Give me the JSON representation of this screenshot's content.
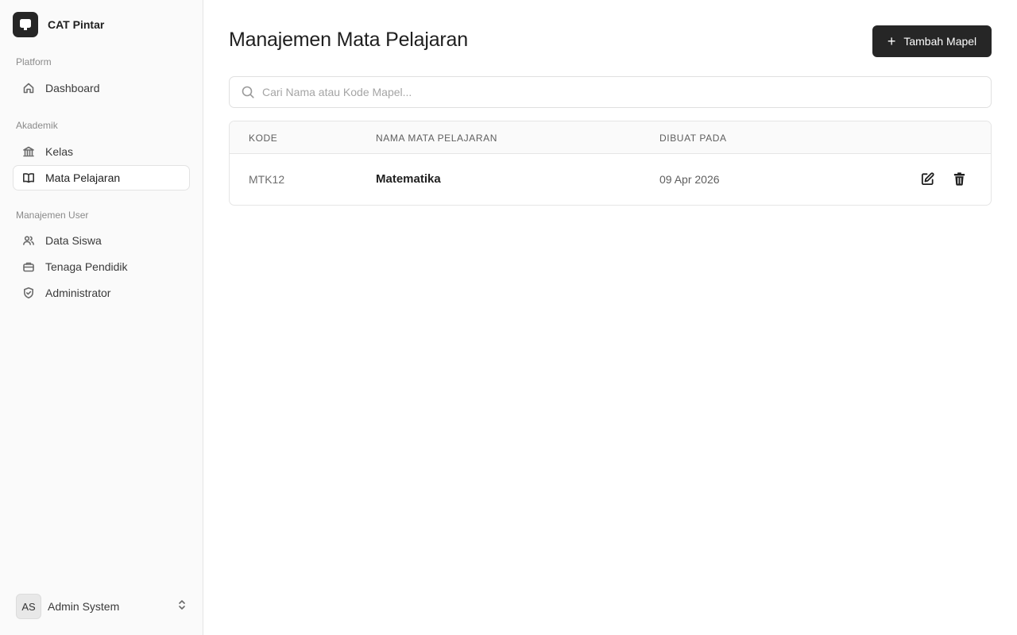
{
  "app": {
    "name": "CAT Pintar"
  },
  "sidebar": {
    "groups": [
      {
        "label": "Platform",
        "items": [
          {
            "label": "Dashboard",
            "icon": "home-icon"
          }
        ]
      },
      {
        "label": "Akademik",
        "items": [
          {
            "label": "Kelas",
            "icon": "bank-icon"
          },
          {
            "label": "Mata Pelajaran",
            "icon": "book-open-icon",
            "active": true
          }
        ]
      },
      {
        "label": "Manajemen User",
        "items": [
          {
            "label": "Data Siswa",
            "icon": "users-icon"
          },
          {
            "label": "Tenaga Pendidik",
            "icon": "briefcase-icon"
          },
          {
            "label": "Administrator",
            "icon": "shield-check-icon"
          }
        ]
      }
    ],
    "user": {
      "initials": "AS",
      "name": "Admin System"
    }
  },
  "main": {
    "title": "Manajemen Mata Pelajaran",
    "add_button": {
      "plus": "+",
      "label": "Tambah Mapel"
    },
    "search": {
      "placeholder": "Cari Nama atau Kode Mapel...",
      "value": ""
    },
    "table": {
      "headers": [
        "KODE",
        "NAMA MATA PELAJARAN",
        "DIBUAT PADA"
      ],
      "rows": [
        {
          "code": "MTK12",
          "name": "Matematika",
          "created_at": "09 Apr 2026"
        }
      ]
    }
  },
  "colors": {
    "accent": "#262626",
    "sidebar_bg": "#fafafa",
    "border": "#e5e5e5"
  }
}
